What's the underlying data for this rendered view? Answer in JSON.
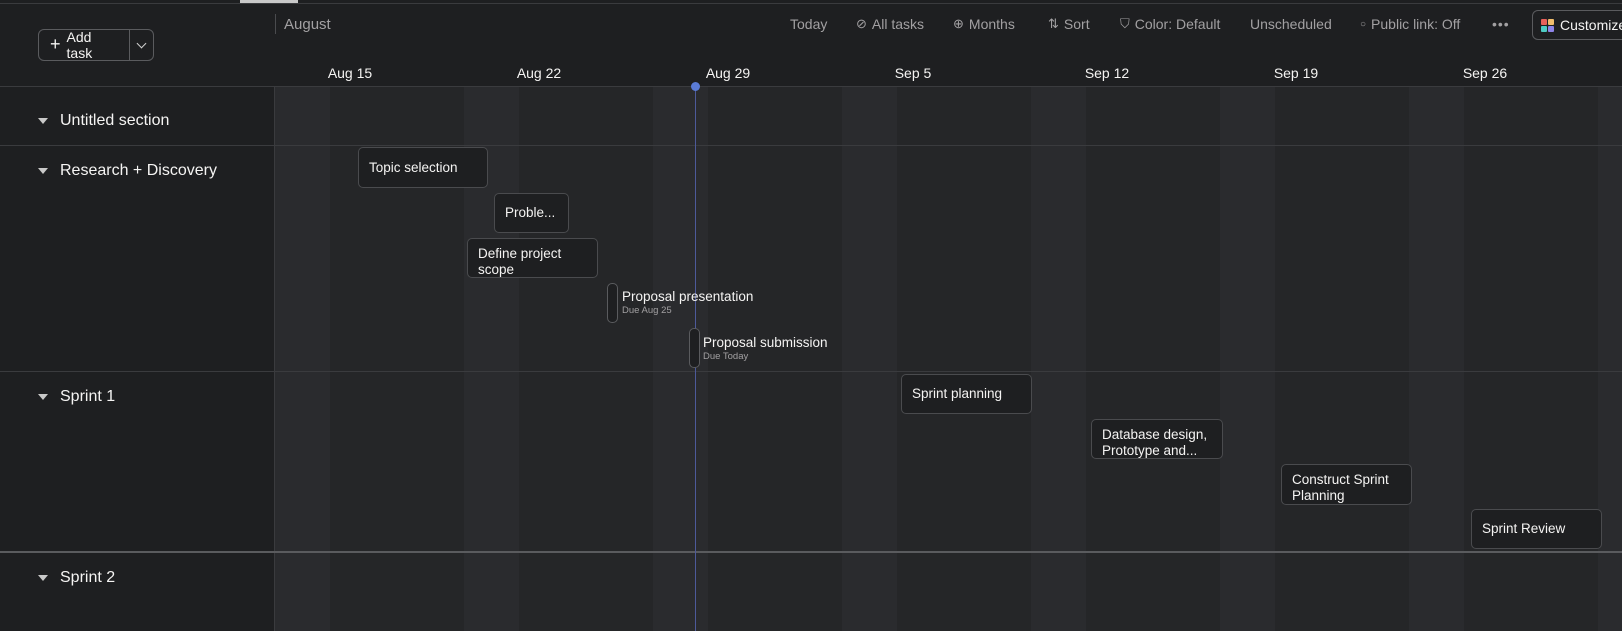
{
  "header": {
    "add_task_label": "Add task",
    "month": "August"
  },
  "toolbar": {
    "today": "Today",
    "all_tasks": "All tasks",
    "months": "Months",
    "sort": "Sort",
    "color": "Color: Default",
    "unscheduled": "Unscheduled",
    "public_link": "Public link: Off",
    "more": "•••",
    "customize": "Customize"
  },
  "dates": [
    "Aug 15",
    "Aug 22",
    "Aug 29",
    "Sep 5",
    "Sep 12",
    "Sep 19",
    "Sep 26"
  ],
  "sections": [
    {
      "name": "Untitled section"
    },
    {
      "name": "Research + Discovery"
    },
    {
      "name": "Sprint 1"
    },
    {
      "name": "Sprint 2"
    }
  ],
  "tasks": {
    "topic_selection": "Topic selection",
    "problem": "Proble...",
    "define_scope": "Define project scope",
    "proposal_presentation": "Proposal presentation",
    "proposal_presentation_due": "Due Aug 25",
    "proposal_submission": "Proposal submission",
    "proposal_submission_due": "Due Today",
    "sprint_planning": "Sprint planning",
    "database_design": "Database design, Prototype and...",
    "construct_sprint_planning": "Construct Sprint Planning",
    "sprint_review": "Sprint Review"
  },
  "colors": {
    "background": "#1e1f21",
    "grid": "#252628",
    "weekend_stripe": "#2a2b2e",
    "today_line": "#5a7bd6"
  }
}
